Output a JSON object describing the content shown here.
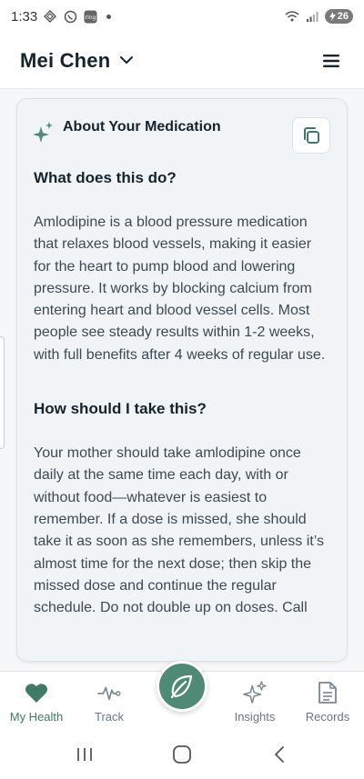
{
  "status_bar": {
    "time": "1:33",
    "notification_badge": "ring",
    "battery_level": "26"
  },
  "header": {
    "profile_name": "Mei Chen"
  },
  "card": {
    "title": "About Your Medication",
    "sections": [
      {
        "heading": "What does this do?",
        "text": "Amlodipine is a blood pressure medication that relaxes blood vessels, making it easier for the heart to pump blood and lowering pressure. It works by blocking calcium from entering heart and blood vessel cells. Most people see steady results within 1-2 weeks, with full benefits after 4 weeks of regular use."
      },
      {
        "heading": "How should I take this?",
        "text": "Your mother should take amlodipine once daily at the same time each day, with or without food—whatever is easiest to remember. If a dose is missed, she should take it as soon as she remembers, unless it’s almost time for the next dose; then skip the missed dose and continue the regular schedule. Do not double up on doses. Call"
      }
    ]
  },
  "bottom_nav": {
    "items": [
      {
        "label": "My Health",
        "icon": "heart-icon",
        "active": true
      },
      {
        "label": "Track",
        "icon": "pulse-icon",
        "active": false
      },
      {
        "label": "Insights",
        "icon": "sparkle-icon",
        "active": false
      },
      {
        "label": "Records",
        "icon": "document-icon",
        "active": false
      }
    ],
    "fab_icon": "leaf-icon"
  },
  "colors": {
    "accent": "#4f8a76",
    "accent_text": "#3e7a66",
    "card_bg": "#f1f4f7",
    "text_primary": "#15232d",
    "text_body": "#3c4a54"
  }
}
